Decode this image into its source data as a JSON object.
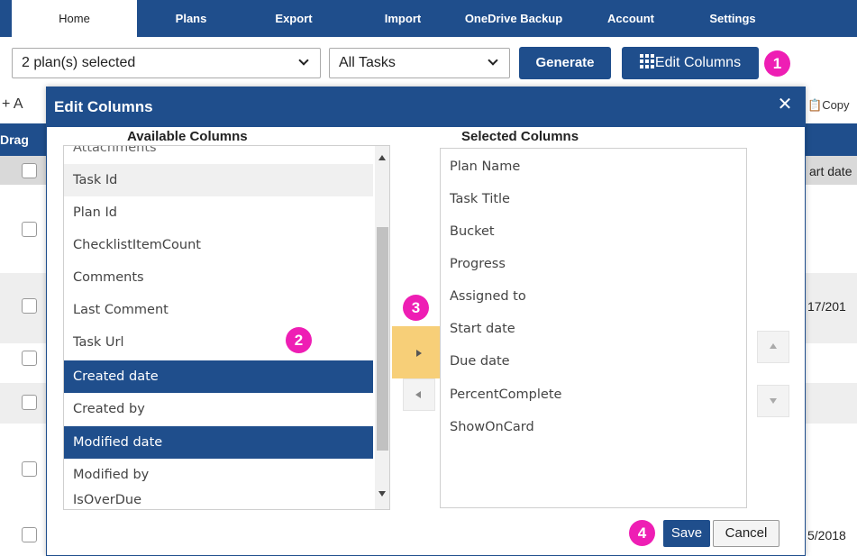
{
  "nav": {
    "tabs": [
      {
        "label": "Home"
      },
      {
        "label": "Plans"
      },
      {
        "label": "Export"
      },
      {
        "label": "Import"
      },
      {
        "label": "OneDrive Backup"
      },
      {
        "label": "Account"
      },
      {
        "label": "Settings"
      }
    ],
    "active_tab": "Home"
  },
  "toolbar": {
    "plan_select_value": "2 plan(s) selected",
    "task_select_value": "All Tasks",
    "generate_label": "Generate",
    "edit_columns_label": "Edit Columns",
    "add_label": "+ A",
    "copy_label": "Copy"
  },
  "background_grid": {
    "drag_header": "Drag",
    "start_date_header": "art date",
    "date_cells": [
      "17/201",
      "5/2018"
    ]
  },
  "modal": {
    "title": "Edit Columns",
    "available_header": "Available Columns",
    "selected_header": "Selected Columns",
    "available_columns": [
      {
        "label": "Attachments",
        "state": "partial"
      },
      {
        "label": "Task Id",
        "state": "hover"
      },
      {
        "label": "Plan Id",
        "state": "normal"
      },
      {
        "label": "ChecklistItemCount",
        "state": "normal"
      },
      {
        "label": "Comments",
        "state": "normal"
      },
      {
        "label": "Last Comment",
        "state": "normal"
      },
      {
        "label": "Task Url",
        "state": "normal"
      },
      {
        "label": "Created date",
        "state": "selected"
      },
      {
        "label": "Created by",
        "state": "normal"
      },
      {
        "label": "Modified date",
        "state": "selected"
      },
      {
        "label": "Modified by",
        "state": "normal"
      },
      {
        "label": "IsOverDue",
        "state": "normal"
      }
    ],
    "selected_columns": [
      "Plan Name",
      "Task Title",
      "Bucket",
      "Progress",
      "Assigned to",
      "Start date",
      "Due date",
      "PercentComplete",
      "ShowOnCard"
    ],
    "save_label": "Save",
    "cancel_label": "Cancel"
  },
  "annotations": {
    "step1": "1",
    "step2": "2",
    "step3": "3",
    "step4": "4"
  },
  "colors": {
    "brand_blue": "#1f4e8c",
    "badge_pink": "#ee1eb4",
    "highlight_yellow": "#f7cf78"
  }
}
